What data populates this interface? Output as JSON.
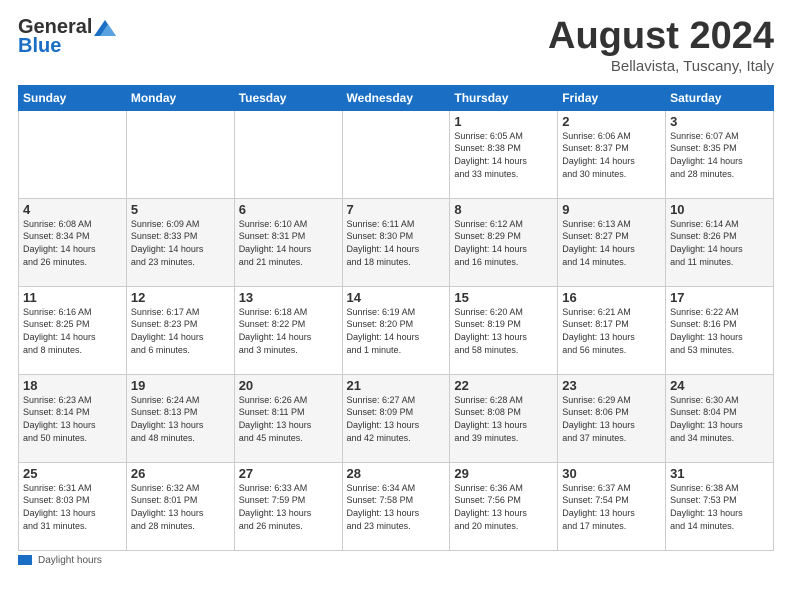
{
  "logo": {
    "general": "General",
    "blue": "Blue"
  },
  "title": "August 2024",
  "location": "Bellavista, Tuscany, Italy",
  "days_of_week": [
    "Sunday",
    "Monday",
    "Tuesday",
    "Wednesday",
    "Thursday",
    "Friday",
    "Saturday"
  ],
  "legend_label": "Daylight hours",
  "weeks": [
    [
      {
        "num": "",
        "info": ""
      },
      {
        "num": "",
        "info": ""
      },
      {
        "num": "",
        "info": ""
      },
      {
        "num": "",
        "info": ""
      },
      {
        "num": "1",
        "info": "Sunrise: 6:05 AM\nSunset: 8:38 PM\nDaylight: 14 hours\nand 33 minutes."
      },
      {
        "num": "2",
        "info": "Sunrise: 6:06 AM\nSunset: 8:37 PM\nDaylight: 14 hours\nand 30 minutes."
      },
      {
        "num": "3",
        "info": "Sunrise: 6:07 AM\nSunset: 8:35 PM\nDaylight: 14 hours\nand 28 minutes."
      }
    ],
    [
      {
        "num": "4",
        "info": "Sunrise: 6:08 AM\nSunset: 8:34 PM\nDaylight: 14 hours\nand 26 minutes."
      },
      {
        "num": "5",
        "info": "Sunrise: 6:09 AM\nSunset: 8:33 PM\nDaylight: 14 hours\nand 23 minutes."
      },
      {
        "num": "6",
        "info": "Sunrise: 6:10 AM\nSunset: 8:31 PM\nDaylight: 14 hours\nand 21 minutes."
      },
      {
        "num": "7",
        "info": "Sunrise: 6:11 AM\nSunset: 8:30 PM\nDaylight: 14 hours\nand 18 minutes."
      },
      {
        "num": "8",
        "info": "Sunrise: 6:12 AM\nSunset: 8:29 PM\nDaylight: 14 hours\nand 16 minutes."
      },
      {
        "num": "9",
        "info": "Sunrise: 6:13 AM\nSunset: 8:27 PM\nDaylight: 14 hours\nand 14 minutes."
      },
      {
        "num": "10",
        "info": "Sunrise: 6:14 AM\nSunset: 8:26 PM\nDaylight: 14 hours\nand 11 minutes."
      }
    ],
    [
      {
        "num": "11",
        "info": "Sunrise: 6:16 AM\nSunset: 8:25 PM\nDaylight: 14 hours\nand 8 minutes."
      },
      {
        "num": "12",
        "info": "Sunrise: 6:17 AM\nSunset: 8:23 PM\nDaylight: 14 hours\nand 6 minutes."
      },
      {
        "num": "13",
        "info": "Sunrise: 6:18 AM\nSunset: 8:22 PM\nDaylight: 14 hours\nand 3 minutes."
      },
      {
        "num": "14",
        "info": "Sunrise: 6:19 AM\nSunset: 8:20 PM\nDaylight: 14 hours\nand 1 minute."
      },
      {
        "num": "15",
        "info": "Sunrise: 6:20 AM\nSunset: 8:19 PM\nDaylight: 13 hours\nand 58 minutes."
      },
      {
        "num": "16",
        "info": "Sunrise: 6:21 AM\nSunset: 8:17 PM\nDaylight: 13 hours\nand 56 minutes."
      },
      {
        "num": "17",
        "info": "Sunrise: 6:22 AM\nSunset: 8:16 PM\nDaylight: 13 hours\nand 53 minutes."
      }
    ],
    [
      {
        "num": "18",
        "info": "Sunrise: 6:23 AM\nSunset: 8:14 PM\nDaylight: 13 hours\nand 50 minutes."
      },
      {
        "num": "19",
        "info": "Sunrise: 6:24 AM\nSunset: 8:13 PM\nDaylight: 13 hours\nand 48 minutes."
      },
      {
        "num": "20",
        "info": "Sunrise: 6:26 AM\nSunset: 8:11 PM\nDaylight: 13 hours\nand 45 minutes."
      },
      {
        "num": "21",
        "info": "Sunrise: 6:27 AM\nSunset: 8:09 PM\nDaylight: 13 hours\nand 42 minutes."
      },
      {
        "num": "22",
        "info": "Sunrise: 6:28 AM\nSunset: 8:08 PM\nDaylight: 13 hours\nand 39 minutes."
      },
      {
        "num": "23",
        "info": "Sunrise: 6:29 AM\nSunset: 8:06 PM\nDaylight: 13 hours\nand 37 minutes."
      },
      {
        "num": "24",
        "info": "Sunrise: 6:30 AM\nSunset: 8:04 PM\nDaylight: 13 hours\nand 34 minutes."
      }
    ],
    [
      {
        "num": "25",
        "info": "Sunrise: 6:31 AM\nSunset: 8:03 PM\nDaylight: 13 hours\nand 31 minutes."
      },
      {
        "num": "26",
        "info": "Sunrise: 6:32 AM\nSunset: 8:01 PM\nDaylight: 13 hours\nand 28 minutes."
      },
      {
        "num": "27",
        "info": "Sunrise: 6:33 AM\nSunset: 7:59 PM\nDaylight: 13 hours\nand 26 minutes."
      },
      {
        "num": "28",
        "info": "Sunrise: 6:34 AM\nSunset: 7:58 PM\nDaylight: 13 hours\nand 23 minutes."
      },
      {
        "num": "29",
        "info": "Sunrise: 6:36 AM\nSunset: 7:56 PM\nDaylight: 13 hours\nand 20 minutes."
      },
      {
        "num": "30",
        "info": "Sunrise: 6:37 AM\nSunset: 7:54 PM\nDaylight: 13 hours\nand 17 minutes."
      },
      {
        "num": "31",
        "info": "Sunrise: 6:38 AM\nSunset: 7:53 PM\nDaylight: 13 hours\nand 14 minutes."
      }
    ]
  ]
}
